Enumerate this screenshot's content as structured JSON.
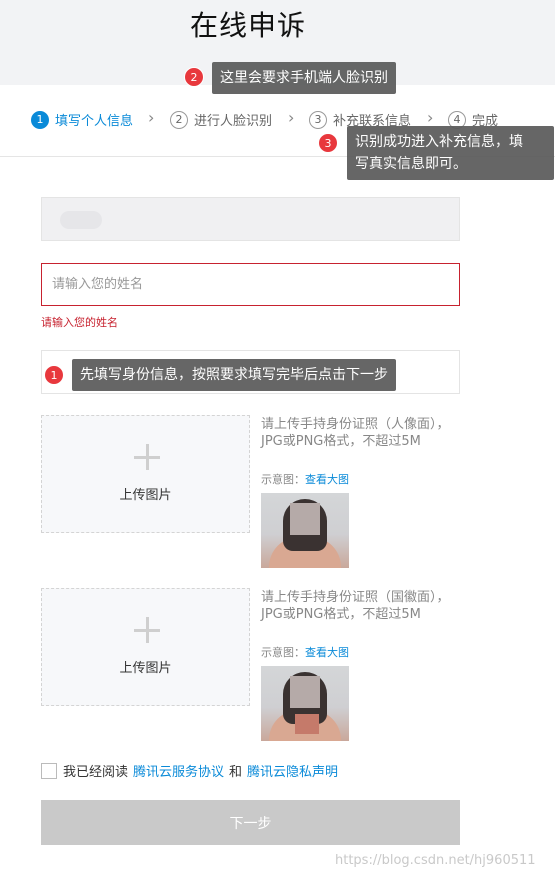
{
  "header": {
    "title": "在线申诉"
  },
  "steps": [
    {
      "num": "1",
      "label": "填写个人信息"
    },
    {
      "num": "2",
      "label": "进行人脸识别"
    },
    {
      "num": "3",
      "label": "补充联系信息"
    },
    {
      "num": "4",
      "label": "完成"
    }
  ],
  "tips": [
    {
      "badge": "1",
      "text": "先填写身份信息，按照要求填写完毕后点击下一步"
    },
    {
      "badge": "2",
      "text": "这里会要求手机端人脸识别"
    },
    {
      "badge": "3",
      "text_line1": "识别成功进入补充信息，填",
      "text_line2": "写真实信息即可。"
    }
  ],
  "form": {
    "name_placeholder": "请输入您的姓名",
    "name_error": "请输入您的姓名",
    "upload_label": "上传图片",
    "front": {
      "desc": "请上传手持身份证照（人像面），JPG或PNG格式，不超过5M"
    },
    "back": {
      "desc": "请上传手持身份证照（国徽面），JPG或PNG格式，不超过5M"
    },
    "sample_label": "示意图：",
    "sample_link": "查看大图",
    "agree_prefix": "我已经阅读",
    "agree_link1": "腾讯云服务协议",
    "agree_and": "和",
    "agree_link2": "腾讯云隐私声明",
    "next_button": "下一步"
  },
  "watermark": "https://blog.csdn.net/hj960511",
  "colors": {
    "accent": "#0a8ad8",
    "error": "#c7222f",
    "badge": "#e8383d",
    "tooltip": "#5a5a5a"
  }
}
